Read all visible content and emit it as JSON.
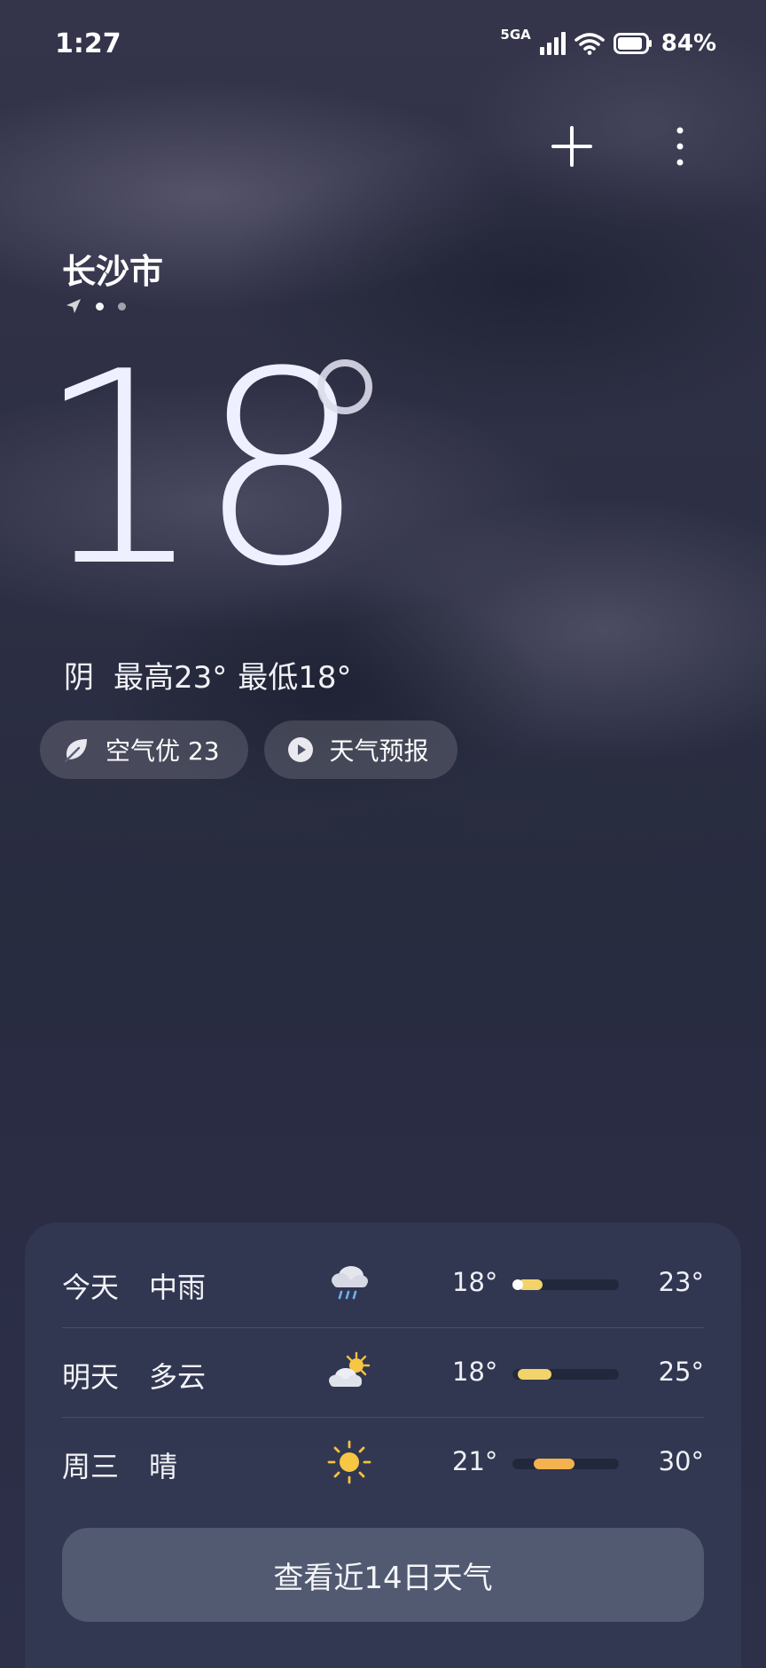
{
  "status_bar": {
    "time": "1:27",
    "network": "5GA",
    "battery": "84%"
  },
  "location": {
    "city": "长沙市",
    "page_count": 2,
    "active_page": 0
  },
  "current": {
    "temperature": "18",
    "condition": "阴",
    "high": "最高23°",
    "low": "最低18°"
  },
  "chips": {
    "air_quality": "空气优 23",
    "forecast_video": "天气预报"
  },
  "forecast": {
    "days": [
      {
        "day": "今天",
        "condition": "中雨",
        "icon": "rain-cloud-icon",
        "low": "18°",
        "high": "23°",
        "bar_start": 0.05,
        "bar_end": 0.28,
        "bar_color": "#f2d36b",
        "has_current_dot": true
      },
      {
        "day": "明天",
        "condition": "多云",
        "icon": "partly-cloudy-icon",
        "low": "18°",
        "high": "25°",
        "bar_start": 0.05,
        "bar_end": 0.37,
        "bar_color": "#f2d36b",
        "has_current_dot": false
      },
      {
        "day": "周三",
        "condition": "晴",
        "icon": "sun-icon",
        "low": "21°",
        "high": "30°",
        "bar_start": 0.2,
        "bar_end": 0.58,
        "bar_color": "#f4b24f",
        "has_current_dot": false
      }
    ],
    "more_button": "查看近14日天气"
  }
}
